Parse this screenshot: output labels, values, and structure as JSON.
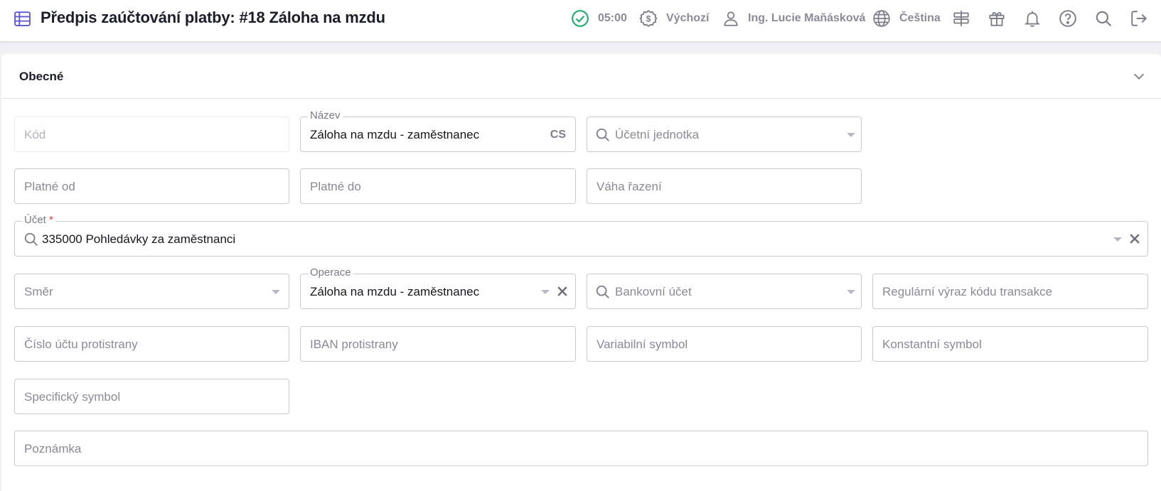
{
  "header": {
    "title": "Předpis zaúčtování platby: #18 Záloha na mzdu",
    "title_icon": "table-icon",
    "timer": "05:00",
    "currency": "Výchozí",
    "user": "Ing. Lucie Maňásková",
    "language": "Čeština"
  },
  "section": {
    "title": "Obecné"
  },
  "fields": {
    "kod": {
      "placeholder": "Kód"
    },
    "nazev": {
      "label": "Název",
      "value": "Záloha na mzdu - zaměstnanec",
      "lang": "CS"
    },
    "ucetni_jednotka": {
      "placeholder": "Účetní jednotka"
    },
    "platne_od": {
      "placeholder": "Platné od"
    },
    "platne_do": {
      "placeholder": "Platné do"
    },
    "vaha_razeni": {
      "placeholder": "Váha řazení"
    },
    "ucet": {
      "label": "Účet",
      "required_mark": "*",
      "value": "335000 Pohledávky za zaměstnanci"
    },
    "smer": {
      "placeholder": "Směr"
    },
    "operace": {
      "label": "Operace",
      "value": "Záloha na mzdu - zaměstnanec"
    },
    "bankovni_ucet": {
      "placeholder": "Bankovní účet"
    },
    "regularni_vyraz": {
      "placeholder": "Regulární výraz kódu transakce"
    },
    "cislo_uctu_protistrany": {
      "placeholder": "Číslo účtu protistrany"
    },
    "iban_protistrany": {
      "placeholder": "IBAN protistrany"
    },
    "variabilni_symbol": {
      "placeholder": "Variabilní symbol"
    },
    "konstantni_symbol": {
      "placeholder": "Konstantní symbol"
    },
    "specificky_symbol": {
      "placeholder": "Specifický symbol"
    },
    "poznamka": {
      "placeholder": "Poznámka"
    }
  },
  "colors": {
    "accent": "#5b57d1",
    "success": "#1fae6e",
    "required": "#e0374a"
  }
}
